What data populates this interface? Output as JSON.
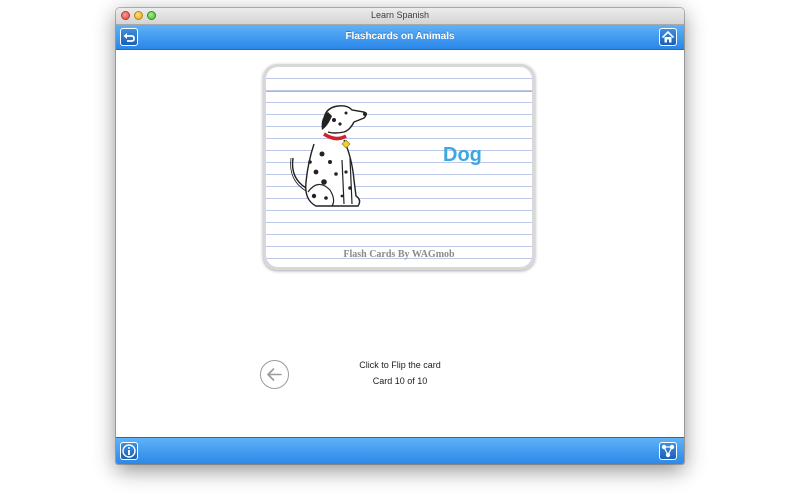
{
  "window": {
    "title": "Learn Spanish"
  },
  "header": {
    "title": "Flashcards on Animals",
    "back_icon": "undo-arrow-icon",
    "home_icon": "home-icon"
  },
  "card": {
    "word": "Dog",
    "footer": "Flash Cards By WAGmob",
    "image": "dalmatian-dog"
  },
  "controls": {
    "prev_icon": "arrow-left-icon",
    "flip_hint": "Click to Flip the card",
    "counter": "Card 10 of 10"
  },
  "footer": {
    "info_icon": "info-icon",
    "share_icon": "share-icon"
  },
  "colors": {
    "bar_top": "#5fb2f7",
    "bar_bottom": "#2a86e8",
    "word": "#3aa7e2",
    "card_border": "#d8d8d8"
  }
}
